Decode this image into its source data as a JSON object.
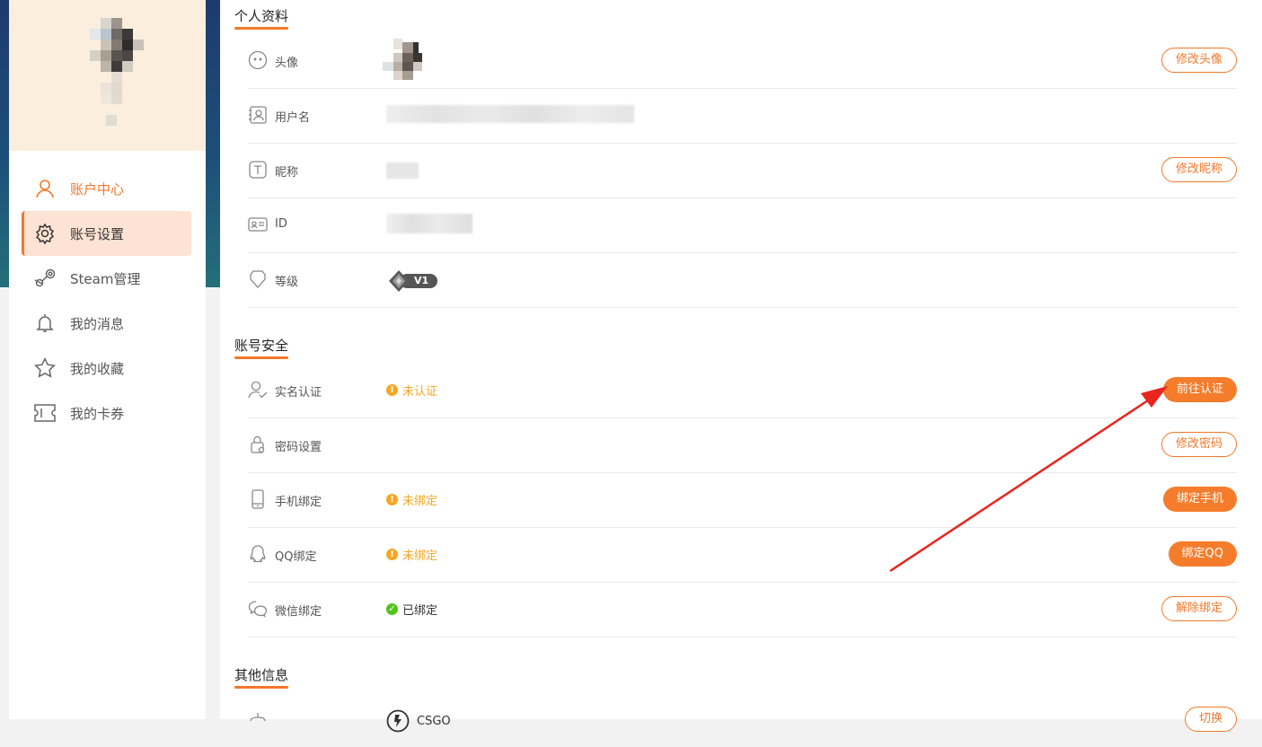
{
  "sidebar": {
    "items": [
      {
        "label": "账户中心",
        "icon": "user-icon"
      },
      {
        "label": "账号设置",
        "icon": "gear-icon"
      },
      {
        "label": "Steam管理",
        "icon": "steam-icon"
      },
      {
        "label": "我的消息",
        "icon": "bell-icon"
      },
      {
        "label": "我的收藏",
        "icon": "star-icon"
      },
      {
        "label": "我的卡券",
        "icon": "ticket-icon"
      }
    ]
  },
  "profile": {
    "title": "个人资料",
    "avatar_label": "头像",
    "avatar_button": "修改头像",
    "username_label": "用户名",
    "nickname_label": "昵称",
    "nickname_button": "修改昵称",
    "id_label": "ID",
    "level_label": "等级",
    "level_value": "V1"
  },
  "security": {
    "title": "账号安全",
    "realname_label": "实名认证",
    "realname_status": "未认证",
    "realname_button": "前往认证",
    "password_label": "密码设置",
    "password_button": "修改密码",
    "phone_label": "手机绑定",
    "phone_status": "未绑定",
    "phone_button": "绑定手机",
    "qq_label": "QQ绑定",
    "qq_status": "未绑定",
    "qq_button": "绑定QQ",
    "wechat_label": "微信绑定",
    "wechat_status": "已绑定",
    "wechat_button": "解除绑定"
  },
  "other": {
    "title": "其他信息",
    "game_value": "CSGO",
    "game_button": "切换"
  },
  "colors": {
    "accent": "#f2782a",
    "warning": "#f5a623",
    "success": "#52c41a",
    "annotation_arrow": "#e8251f"
  }
}
